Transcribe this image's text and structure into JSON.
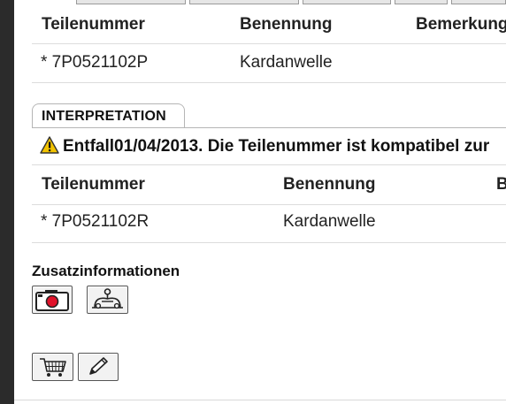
{
  "colors": {
    "sidebar": "#2b2b2b",
    "warning": "#f2c300",
    "camera_dot": "#e0122a"
  },
  "table1": {
    "headers": [
      "Teilenummer",
      "Benennung",
      "Bemerkung"
    ],
    "rows": [
      {
        "part": "* 7P0521102P",
        "name": "Kardanwelle"
      }
    ]
  },
  "interpretation": {
    "tab_label": "INTERPRETATION",
    "notice": "Entfall01/04/2013. Die Teilenummer ist kompatibel zur",
    "notice_icon": "warning-icon"
  },
  "table2": {
    "headers": [
      "Teilenummer",
      "Benennung",
      "B"
    ],
    "rows": [
      {
        "part": "* 7P0521102R",
        "name": "Kardanwelle"
      }
    ]
  },
  "additional": {
    "title": "Zusatzinformationen",
    "buttons": [
      "camera-icon",
      "mechanic-icon"
    ]
  },
  "actions": {
    "buttons": [
      "cart-icon",
      "pencil-icon"
    ]
  }
}
